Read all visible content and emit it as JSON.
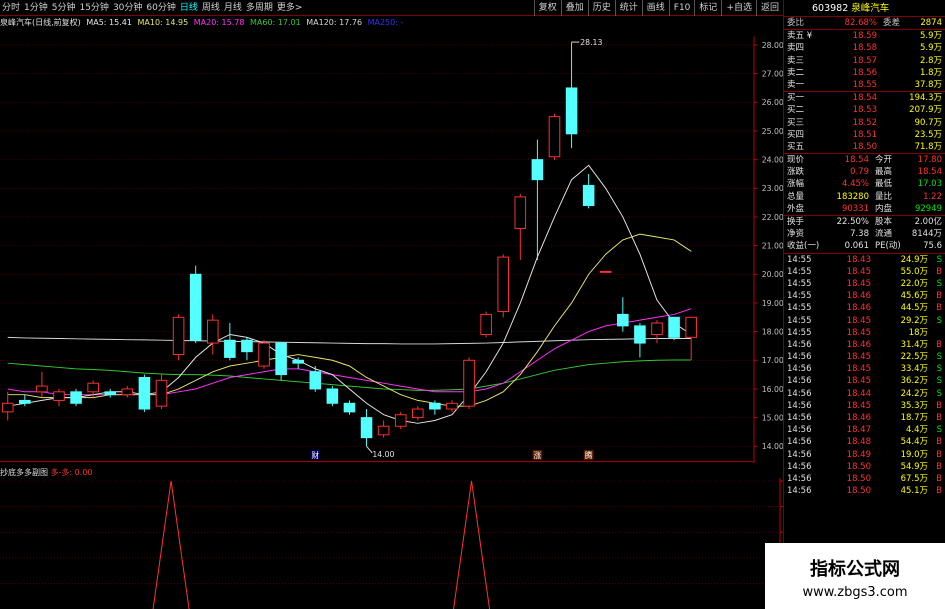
{
  "topbar": {
    "periods": [
      "分时",
      "1分钟",
      "5分钟",
      "15分钟",
      "30分钟",
      "60分钟",
      "日线",
      "周线",
      "月线",
      "多周期",
      "更多>"
    ],
    "active": "日线",
    "right_buttons": [
      "复权",
      "叠加",
      "历史",
      "统计",
      "画线",
      "F10",
      "标记",
      "+自选",
      "返回"
    ]
  },
  "info": {
    "name": "泉峰汽车(日线,前复权)",
    "ma5": "MA5: 15.41",
    "ma10": "MA10: 14.95",
    "ma20": "MA20: 15.78",
    "ma60": "MA60: 17.01",
    "ma120": "MA120: 17.76",
    "ma250": "MA250: -"
  },
  "indicator": {
    "name": "抄底多多副图",
    "value": "多-多: 0.00",
    "ticks": [
      "1.00",
      "0.80",
      "0.60",
      "0.40",
      "0.20"
    ]
  },
  "stock": {
    "code": "603982",
    "name": "泉峰汽车"
  },
  "weibi": {
    "l1": "委比",
    "v1": "82.68%",
    "l2": "委差",
    "v2": "2874"
  },
  "asks": [
    {
      "label": "卖五 ¥",
      "price": "18.59",
      "vol": "5.9万"
    },
    {
      "label": "卖四",
      "price": "18.58",
      "vol": "5.9万"
    },
    {
      "label": "卖三",
      "price": "18.57",
      "vol": "2.8万"
    },
    {
      "label": "卖二",
      "price": "18.56",
      "vol": "1.8万"
    },
    {
      "label": "卖一",
      "price": "18.55",
      "vol": "37.8万"
    }
  ],
  "bids": [
    {
      "label": "买一",
      "price": "18.54",
      "vol": "194.3万"
    },
    {
      "label": "买二",
      "price": "18.53",
      "vol": "207.9万"
    },
    {
      "label": "买三",
      "price": "18.52",
      "vol": "90.7万"
    },
    {
      "label": "买四",
      "price": "18.51",
      "vol": "23.5万"
    },
    {
      "label": "买五",
      "price": "18.50",
      "vol": "71.8万"
    }
  ],
  "quote": [
    {
      "l1": "现价",
      "v1": "18.54",
      "l2": "今开",
      "v2": "17.80"
    },
    {
      "l1": "涨跌",
      "v1": "0.79",
      "l2": "最高",
      "v2": "18.54"
    },
    {
      "l1": "涨幅",
      "v1": "4.45%",
      "l2": "最低",
      "v2": "17.03"
    },
    {
      "l1": "总量",
      "v1": "183280",
      "l2": "量比",
      "v2": "1.22"
    },
    {
      "l1": "外盘",
      "v1": "90331",
      "l2": "内盘",
      "v2": "92949"
    }
  ],
  "stats": [
    {
      "l1": "换手",
      "v1": "22.50%",
      "l2": "股本",
      "v2": "2.00亿"
    },
    {
      "l1": "净资",
      "v1": "7.38",
      "l2": "流通",
      "v2": "8144万"
    },
    {
      "l1": "收益(一)",
      "v1": "0.061",
      "l2": "PE(动)",
      "v2": "75.6"
    }
  ],
  "ticks": [
    {
      "t": "14:55",
      "p": "18.43",
      "v": "24.9万",
      "s": "S"
    },
    {
      "t": "14:55",
      "p": "18.45",
      "v": "55.0万",
      "s": "B"
    },
    {
      "t": "14:55",
      "p": "18.45",
      "v": "22.0万",
      "s": "S"
    },
    {
      "t": "14:55",
      "p": "18.46",
      "v": "45.6万",
      "s": "B"
    },
    {
      "t": "14:55",
      "p": "18.46",
      "v": "44.5万",
      "s": "B"
    },
    {
      "t": "14:55",
      "p": "18.45",
      "v": "29.2万",
      "s": "S"
    },
    {
      "t": "14:55",
      "p": "18.45",
      "v": "18万",
      "s": ""
    },
    {
      "t": "14:56",
      "p": "18.46",
      "v": "31.4万",
      "s": "B"
    },
    {
      "t": "14:56",
      "p": "18.45",
      "v": "22.5万",
      "s": "S"
    },
    {
      "t": "14:56",
      "p": "18.45",
      "v": "33.4万",
      "s": "S"
    },
    {
      "t": "14:56",
      "p": "18.45",
      "v": "36.2万",
      "s": "S"
    },
    {
      "t": "14:56",
      "p": "18.44",
      "v": "24.2万",
      "s": "S"
    },
    {
      "t": "14:56",
      "p": "18.45",
      "v": "35.3万",
      "s": "B"
    },
    {
      "t": "14:56",
      "p": "18.46",
      "v": "18.7万",
      "s": "B"
    },
    {
      "t": "14:56",
      "p": "18.47",
      "v": "4.4万",
      "s": "S"
    },
    {
      "t": "14:56",
      "p": "18.48",
      "v": "54.4万",
      "s": "B"
    },
    {
      "t": "14:56",
      "p": "18.49",
      "v": "19.0万",
      "s": "B"
    },
    {
      "t": "14:56",
      "p": "18.50",
      "v": "54.9万",
      "s": "B"
    },
    {
      "t": "14:56",
      "p": "18.50",
      "v": "67.5万",
      "s": "B"
    },
    {
      "t": "14:56",
      "p": "18.50",
      "v": "45.1万",
      "s": "B"
    }
  ],
  "watermark": {
    "line1": "指标公式网",
    "line2": "www.zbgs3.com"
  },
  "chart_data": {
    "type": "candlestick",
    "y_ticks": [
      "28.00",
      "27.00",
      "26.00",
      "25.00",
      "24.00",
      "23.00",
      "22.00",
      "21.00",
      "20.00",
      "19.00",
      "18.00",
      "17.00",
      "16.00",
      "15.00",
      "14.00"
    ],
    "ylim": [
      13.8,
      28.3
    ],
    "annotations": {
      "high": "28.13",
      "low": "14.00",
      "event_marks": [
        "财",
        "涨",
        "腾"
      ]
    },
    "candles": [
      {
        "o": 15.2,
        "c": 15.5,
        "h": 15.9,
        "l": 14.9
      },
      {
        "o": 15.6,
        "c": 15.5,
        "h": 15.8,
        "l": 15.4
      },
      {
        "o": 15.9,
        "c": 16.1,
        "h": 16.6,
        "l": 15.7
      },
      {
        "o": 15.6,
        "c": 15.9,
        "h": 16.0,
        "l": 15.4
      },
      {
        "o": 15.9,
        "c": 15.5,
        "h": 16.0,
        "l": 15.4
      },
      {
        "o": 15.9,
        "c": 16.2,
        "h": 16.3,
        "l": 15.7
      },
      {
        "o": 15.9,
        "c": 15.8,
        "h": 16.0,
        "l": 15.7
      },
      {
        "o": 15.8,
        "c": 16.0,
        "h": 16.1,
        "l": 15.7
      },
      {
        "o": 16.4,
        "c": 15.3,
        "h": 16.5,
        "l": 15.2
      },
      {
        "o": 15.4,
        "c": 16.3,
        "h": 16.5,
        "l": 15.3
      },
      {
        "o": 17.2,
        "c": 18.5,
        "h": 18.6,
        "l": 17.0
      },
      {
        "o": 20.0,
        "c": 17.7,
        "h": 20.3,
        "l": 17.6
      },
      {
        "o": 17.6,
        "c": 18.4,
        "h": 18.6,
        "l": 17.2
      },
      {
        "o": 17.7,
        "c": 17.1,
        "h": 18.3,
        "l": 17.0
      },
      {
        "o": 17.7,
        "c": 17.3,
        "h": 17.8,
        "l": 17.0
      },
      {
        "o": 16.8,
        "c": 17.6,
        "h": 17.7,
        "l": 16.7
      },
      {
        "o": 17.6,
        "c": 16.5,
        "h": 17.6,
        "l": 16.3
      },
      {
        "o": 17.0,
        "c": 16.9,
        "h": 17.1,
        "l": 16.7
      },
      {
        "o": 16.6,
        "c": 16.0,
        "h": 16.8,
        "l": 15.9
      },
      {
        "o": 16.0,
        "c": 15.5,
        "h": 16.1,
        "l": 15.4
      },
      {
        "o": 15.5,
        "c": 15.2,
        "h": 15.6,
        "l": 15.1
      },
      {
        "o": 15.0,
        "c": 14.3,
        "h": 15.3,
        "l": 14.0
      },
      {
        "o": 14.4,
        "c": 14.7,
        "h": 14.9,
        "l": 14.3
      },
      {
        "o": 14.7,
        "c": 15.1,
        "h": 15.2,
        "l": 14.6
      },
      {
        "o": 15.0,
        "c": 15.3,
        "h": 15.4,
        "l": 14.9
      },
      {
        "o": 15.5,
        "c": 15.3,
        "h": 15.6,
        "l": 15.1
      },
      {
        "o": 15.3,
        "c": 15.5,
        "h": 15.6,
        "l": 15.2
      },
      {
        "o": 15.4,
        "c": 17.0,
        "h": 17.1,
        "l": 15.3
      },
      {
        "o": 17.9,
        "c": 18.6,
        "h": 18.7,
        "l": 17.8
      },
      {
        "o": 18.7,
        "c": 20.6,
        "h": 20.7,
        "l": 18.5
      },
      {
        "o": 21.6,
        "c": 22.7,
        "h": 22.8,
        "l": 20.5
      },
      {
        "o": 24.0,
        "c": 23.3,
        "h": 24.7,
        "l": 20.5
      },
      {
        "o": 24.1,
        "c": 25.5,
        "h": 25.6,
        "l": 24.0
      },
      {
        "o": 26.5,
        "c": 24.9,
        "h": 28.1,
        "l": 24.4
      },
      {
        "o": 23.1,
        "c": 22.4,
        "h": 23.5,
        "l": 22.3
      },
      {
        "o": 20.1,
        "c": 20.1,
        "h": 20.1,
        "l": 20.1
      },
      {
        "o": 18.6,
        "c": 18.2,
        "h": 19.2,
        "l": 18.0
      },
      {
        "o": 18.2,
        "c": 17.6,
        "h": 18.3,
        "l": 17.1
      },
      {
        "o": 17.9,
        "c": 18.3,
        "h": 18.4,
        "l": 17.6
      },
      {
        "o": 18.5,
        "c": 17.8,
        "h": 18.5,
        "l": 17.7
      },
      {
        "o": 17.8,
        "c": 18.5,
        "h": 18.5,
        "l": 17.0
      }
    ],
    "ma5": [
      15.4,
      15.5,
      15.6,
      15.7,
      15.7,
      15.8,
      15.9,
      15.9,
      15.8,
      15.9,
      16.4,
      17.1,
      17.6,
      17.9,
      17.8,
      17.6,
      17.2,
      17.0,
      16.7,
      16.5,
      16.0,
      15.5,
      15.1,
      14.9,
      14.8,
      14.9,
      15.1,
      15.8,
      16.6,
      17.6,
      19.0,
      20.6,
      22.0,
      23.3,
      23.8,
      23.0,
      22.0,
      20.7,
      19.1,
      18.3,
      17.9
    ],
    "ma10": [
      15.8,
      15.8,
      15.7,
      15.7,
      15.7,
      15.7,
      15.8,
      15.8,
      15.8,
      15.8,
      16.0,
      16.3,
      16.6,
      16.8,
      16.9,
      17.0,
      17.1,
      17.2,
      17.1,
      17.0,
      16.8,
      16.4,
      16.1,
      15.8,
      15.6,
      15.5,
      15.4,
      15.4,
      15.6,
      15.9,
      16.5,
      17.3,
      18.2,
      19.0,
      20.0,
      20.7,
      21.2,
      21.4,
      21.3,
      21.2,
      20.8
    ],
    "ma20": [
      16.0,
      15.9,
      15.9,
      15.8,
      15.8,
      15.8,
      15.8,
      15.8,
      15.8,
      15.8,
      15.9,
      16.0,
      16.2,
      16.4,
      16.5,
      16.6,
      16.7,
      16.7,
      16.6,
      16.5,
      16.4,
      16.3,
      16.2,
      16.1,
      16.0,
      15.9,
      15.9,
      15.9,
      16.0,
      16.2,
      16.6,
      17.0,
      17.4,
      17.7,
      18.0,
      18.2,
      18.3,
      18.4,
      18.5,
      18.6,
      18.8
    ],
    "ma60": [
      16.9,
      16.85,
      16.8,
      16.75,
      16.7,
      16.68,
      16.65,
      16.6,
      16.55,
      16.52,
      16.5,
      16.5,
      16.48,
      16.45,
      16.4,
      16.35,
      16.3,
      16.25,
      16.2,
      16.15,
      16.1,
      16.05,
      16.0,
      15.98,
      15.95,
      15.95,
      15.97,
      16.0,
      16.1,
      16.2,
      16.35,
      16.5,
      16.65,
      16.75,
      16.85,
      16.9,
      16.95,
      16.98,
      17.0,
      17.01,
      17.01
    ],
    "ma120": [
      17.8,
      17.78,
      17.77,
      17.76,
      17.75,
      17.74,
      17.73,
      17.72,
      17.71,
      17.7,
      17.69,
      17.68,
      17.67,
      17.66,
      17.65,
      17.64,
      17.63,
      17.62,
      17.61,
      17.6,
      17.59,
      17.58,
      17.58,
      17.57,
      17.57,
      17.57,
      17.58,
      17.59,
      17.6,
      17.62,
      17.64,
      17.66,
      17.68,
      17.7,
      17.72,
      17.73,
      17.74,
      17.75,
      17.76,
      17.76,
      17.76
    ],
    "indicator_peaks": [
      9,
      26
    ],
    "colors": {
      "up": "#ff3232",
      "down": "#54ffff",
      "ma5": "#e6e6e6",
      "ma10": "#e6e66e",
      "ma20": "#ff32ff",
      "ma60": "#32c832",
      "ma120": "#d7d7d7",
      "grid": "#800000",
      "axis": "#c80000"
    }
  }
}
